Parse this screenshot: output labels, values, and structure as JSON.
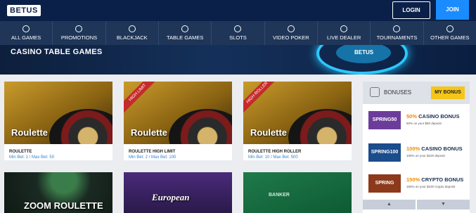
{
  "header": {
    "logo": "BETUS",
    "login_label": "LOGIN",
    "join_label": "JOIN"
  },
  "nav": [
    {
      "label": "ALL GAMES",
      "icon": "cards-icon"
    },
    {
      "label": "PROMOTIONS",
      "icon": "gift-icon"
    },
    {
      "label": "BLACKJACK",
      "icon": "blackjack-icon"
    },
    {
      "label": "TABLE GAMES",
      "icon": "chip-icon"
    },
    {
      "label": "SLOTS",
      "icon": "slots-icon"
    },
    {
      "label": "VIDEO POKER",
      "icon": "poker-icon"
    },
    {
      "label": "LIVE DEALER",
      "icon": "dealer-icon"
    },
    {
      "label": "TOURNAMENTS",
      "icon": "trophy-icon"
    },
    {
      "label": "OTHER GAMES",
      "icon": "more-icon"
    }
  ],
  "hero": {
    "title": "CASINO TABLE GAMES",
    "logo": "BETUS"
  },
  "games": [
    {
      "name": "Roulette",
      "title": "ROULETTE",
      "sub": "Min Bet: 1 / Max Bet: 50",
      "ribbon": ""
    },
    {
      "name": "Roulette",
      "title": "ROULETTE HIGH LIMIT",
      "sub": "Min Bet: 2 / Max Bet: 100",
      "ribbon": "HIGH LIMIT"
    },
    {
      "name": "Roulette",
      "title": "ROULETTE HIGH ROLLER",
      "sub": "Min Bet: 10 / Max Bet: 500",
      "ribbon": "HIGH ROLLER"
    }
  ],
  "games_row2": [
    {
      "name": "ZOOM ROULETTE"
    },
    {
      "name": "European"
    },
    {
      "name": "BANKER"
    }
  ],
  "sidebar": {
    "title": "BONUSES",
    "my_bonus_label": "MY BONUS",
    "bonuses": [
      {
        "code": "SPRING50",
        "pct": "50%",
        "title": "CASINO BONUS",
        "sub": "50% on your $50 deposit",
        "color": "#6c3c9b"
      },
      {
        "code": "SPRING100",
        "pct": "100%",
        "title": "CASINO BONUS",
        "sub": "100% on your $100 deposit",
        "color": "#1b4c8c"
      },
      {
        "code": "SPRING",
        "pct": "150%",
        "title": "CRYPTO BONUS",
        "sub": "150% on your $100 Crypto deposit",
        "color": "#8c3a1b"
      }
    ],
    "up_arrow": "▲",
    "down_arrow": "▼"
  }
}
